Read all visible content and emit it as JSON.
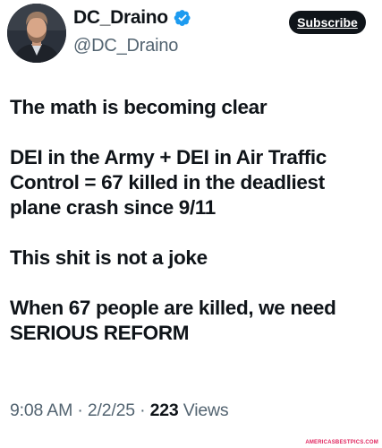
{
  "author": {
    "display_name": "DC_Draino",
    "handle": "@DC_Draino",
    "verified_badge_icon": "verified-badge-icon",
    "avatar": "avatar-photo"
  },
  "subscribe_label": "Subscribe",
  "tweet": {
    "paragraphs": [
      "The math is becoming clear",
      "DEI in the Army + DEI in Air Traffic\nControl = 67 killed in the deadliest\nplane crash since 9/11",
      "This shit is not a joke",
      "When 67 people are killed, we need\nSERIOUS REFORM"
    ]
  },
  "meta": {
    "time": "9:08 AM",
    "separator": "·",
    "date": "2/2/25",
    "views_count": "223",
    "views_label": "Views"
  },
  "watermark": "AMERICASBESTPICS.COM",
  "colors": {
    "text": "#0f1419",
    "secondary": "#536471",
    "verified": "#1d9bf0",
    "button_bg": "#0f1419"
  }
}
